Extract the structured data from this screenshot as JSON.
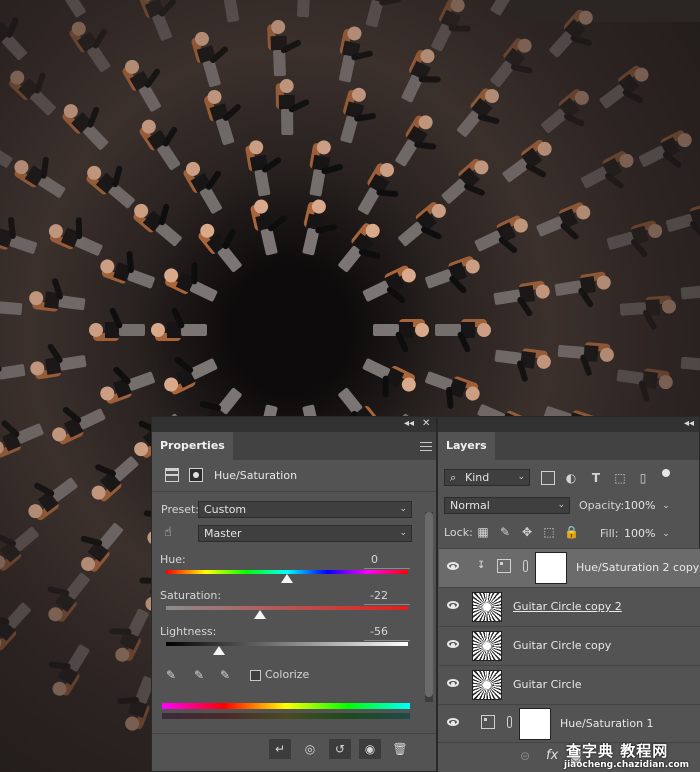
{
  "properties_panel": {
    "tab": "Properties",
    "collapse": "◂◂",
    "close": "✕",
    "adjustment_title": "Hue/Saturation",
    "preset_label": "Preset:",
    "preset_value": "Custom",
    "channel_value": "Master",
    "hue_label": "Hue:",
    "hue_value": "0",
    "saturation_label": "Saturation:",
    "saturation_value": "-22",
    "lightness_label": "Lightness:",
    "lightness_value": "-56",
    "colorize_label": "Colorize",
    "hue_level": 0,
    "saturation_level": -22,
    "lightness_level": -56
  },
  "layers_panel": {
    "tab": "Layers",
    "filter_kind": "Kind",
    "blend_mode": "Normal",
    "opacity_label": "Opacity:",
    "opacity_value": "100%",
    "lock_label": "Lock:",
    "fill_label": "Fill:",
    "fill_value": "100%",
    "layers": [
      {
        "name": "Hue/Saturation 2 copy",
        "type": "adjustment",
        "selected": true,
        "clipped": true
      },
      {
        "name": "Guitar Circle copy 2",
        "type": "image",
        "selected": false
      },
      {
        "name": "Guitar Circle copy",
        "type": "image",
        "selected": false
      },
      {
        "name": "Guitar Circle",
        "type": "image",
        "selected": false
      },
      {
        "name": "Hue/Saturation 1",
        "type": "adjustment",
        "selected": false
      }
    ],
    "footer_icons": [
      "link-icon",
      "fx-icon",
      "mask-icon",
      "adjustment-icon",
      "folder-icon",
      "new-layer-icon",
      "trash-icon"
    ],
    "fx_label": "fx"
  },
  "watermark": {
    "line1": "查字典 教程网",
    "line2": "jiaocheng.chazidian.com"
  },
  "colors": {
    "panel_bg": "#535353",
    "panel_dark": "#323232",
    "selected_layer": "#6b6b6b"
  }
}
